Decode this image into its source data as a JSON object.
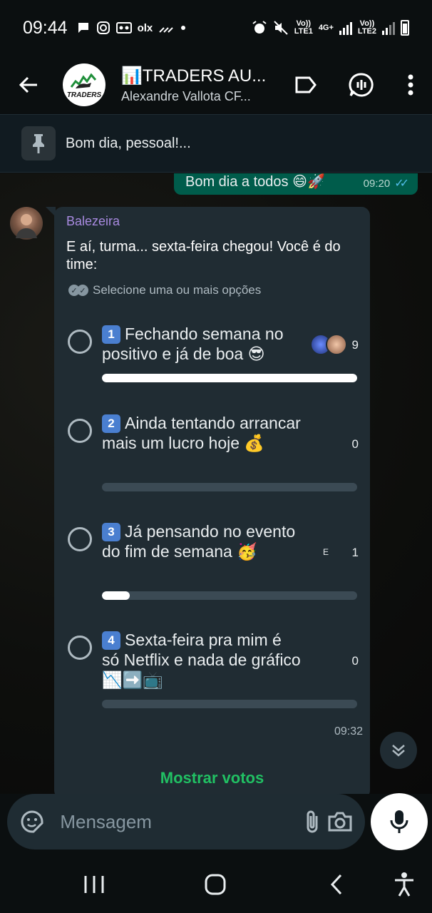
{
  "status_bar": {
    "time": "09:44",
    "left_icons": [
      "chat-bubble-icon",
      "instagram-icon",
      "voicemail-icon",
      "olx-icon",
      "signal-scratch-icon",
      "dot-icon"
    ],
    "olx_label": "olx",
    "sim1_top": "Vo))",
    "sim1_bottom": "LTE1",
    "net_top": "4G+",
    "sim2_top": "Vo))",
    "sim2_bottom": "LTE2"
  },
  "header": {
    "title": "📊TRADERS AU...",
    "subtitle": "Alexandre Vallota CF...",
    "avatar_text": "TRADERS"
  },
  "pinned": {
    "text": "Bom dia, pessoal!..."
  },
  "outgoing": {
    "text": "Bom dia a todos 😄🚀",
    "time": "09:20"
  },
  "poll": {
    "sender": "Balezeira",
    "question": "E aí, turma... sexta-feira chegou! Você é do time:",
    "hint": "Selecione uma ou mais opções",
    "options": [
      {
        "num": "1",
        "text": "Fechando semana no positivo e já de boa 😎",
        "votes": "9",
        "fraction": 1.0,
        "voter_letter": ""
      },
      {
        "num": "2",
        "text": "Ainda tentando arrancar mais um lucro hoje 💰",
        "votes": "0",
        "fraction": 0.0,
        "voter_letter": ""
      },
      {
        "num": "3",
        "text": "Já pensando no evento do fim de semana 🥳",
        "votes": "1",
        "fraction": 0.11,
        "voter_letter": "E"
      },
      {
        "num": "4",
        "text": "Sexta-feira pra mim é só Netflix e nada de gráfico 📉➡️📺",
        "votes": "0",
        "fraction": 0.0,
        "voter_letter": ""
      }
    ],
    "time": "09:32",
    "show_votes": "Mostrar votos"
  },
  "composer": {
    "placeholder": "Mensagem"
  },
  "colors": {
    "outgoing_bubble": "#005c4b",
    "incoming_bubble": "#202c33",
    "accent_green": "#21c063",
    "sender_name": "#a88ae0",
    "read_ticks": "#53bdeb"
  }
}
